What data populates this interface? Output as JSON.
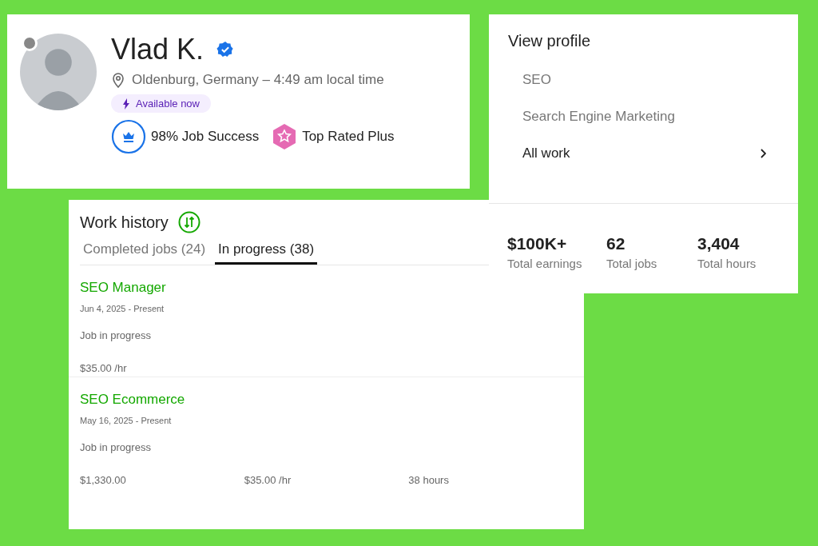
{
  "profile": {
    "name": "Vlad K.",
    "verified": true,
    "online": false,
    "location": "Oldenburg, Germany – 4:49 am local time",
    "availability": "Available now",
    "job_success": "98% Job Success",
    "badge": "Top Rated Plus"
  },
  "menu": {
    "title": "View profile",
    "items": [
      {
        "label": "SEO",
        "kind": "plain"
      },
      {
        "label": "Search Engine Marketing",
        "kind": "plain"
      },
      {
        "label": "All work",
        "kind": "link"
      }
    ]
  },
  "stats": [
    {
      "value": "$100K+",
      "label": "Total earnings"
    },
    {
      "value": "62",
      "label": "Total jobs"
    },
    {
      "value": "3,404",
      "label": "Total hours"
    }
  ],
  "work_history": {
    "title": "Work history",
    "tabs": [
      {
        "label": "Completed jobs (24)",
        "selected": false
      },
      {
        "label": "In progress (38)",
        "selected": true
      }
    ],
    "jobs": [
      {
        "title": "SEO Manager",
        "dates": "Jun 4, 2025 - Present",
        "status": "Job in progress",
        "figures": [
          "$35.00 /hr"
        ]
      },
      {
        "title": "SEO Ecommerce",
        "dates": "May 16, 2025 - Present",
        "status": "Job in progress",
        "figures": [
          "$1,330.00",
          "$35.00 /hr",
          "38 hours"
        ]
      }
    ]
  }
}
